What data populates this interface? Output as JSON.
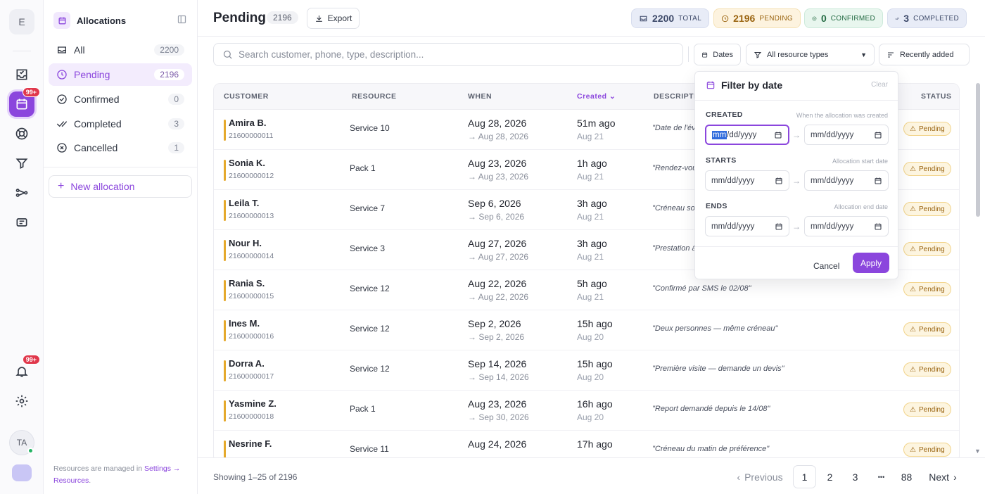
{
  "rail": {
    "workspace_initial": "E",
    "calendar_badge": "99+",
    "notif_badge": "99+",
    "avatar_initials": "TA"
  },
  "panel": {
    "title": "Allocations",
    "nav": [
      {
        "label": "All",
        "count": "2200"
      },
      {
        "label": "Pending",
        "count": "2196"
      },
      {
        "label": "Confirmed",
        "count": "0"
      },
      {
        "label": "Completed",
        "count": "3"
      },
      {
        "label": "Cancelled",
        "count": "1"
      }
    ],
    "new_label": "New allocation",
    "footer_text": "Resources are managed in",
    "footer_link": "Settings → Resources",
    "footer_end": "."
  },
  "header": {
    "title": "Pending",
    "count": "2196",
    "export_label": "Export",
    "stats": [
      {
        "value": "2200",
        "label": "TOTAL"
      },
      {
        "value": "2196",
        "label": "PENDING"
      },
      {
        "value": "0",
        "label": "CONFIRMED"
      },
      {
        "value": "3",
        "label": "COMPLETED"
      }
    ]
  },
  "toolbar": {
    "search_placeholder": "Search customer, phone, type, description...",
    "dates_label": "Dates",
    "type_filter": "All resource types",
    "sort_label": "Recently added"
  },
  "table": {
    "columns": [
      "CUSTOMER",
      "RESOURCE",
      "WHEN",
      "Created",
      "DESCRIPTIO",
      "STATUS"
    ],
    "rows": [
      {
        "name": "Amira B.",
        "phone": "21600000011",
        "resource": "Service 10",
        "when": "Aug 28, 2026",
        "when_end": "→ Aug 28, 2026",
        "created": "51m ago",
        "created_date": "Aug 21",
        "desc": "\"Date de l'évé",
        "status": "Pending"
      },
      {
        "name": "Sonia K.",
        "phone": "21600000012",
        "resource": "Pack 1",
        "when": "Aug 23, 2026",
        "when_end": "→ Aug 23, 2026",
        "created": "1h ago",
        "created_date": "Aug 21",
        "desc": "\"Rendez-vous",
        "status": "Pending"
      },
      {
        "name": "Leila T.",
        "phone": "21600000013",
        "resource": "Service 7",
        "when": "Sep 6, 2026",
        "when_end": "→ Sep 6, 2026",
        "created": "3h ago",
        "created_date": "Aug 21",
        "desc": "\"Créneau sou",
        "status": "Pending"
      },
      {
        "name": "Nour H.",
        "phone": "21600000014",
        "resource": "Service 3",
        "when": "Aug 27, 2026",
        "when_end": "→ Aug 27, 2026",
        "created": "3h ago",
        "created_date": "Aug 21",
        "desc": "\"Prestation à",
        "status": "Pending"
      },
      {
        "name": "Rania S.",
        "phone": "21600000015",
        "resource": "Service 12",
        "when": "Aug 22, 2026",
        "when_end": "→ Aug 22, 2026",
        "created": "5h ago",
        "created_date": "Aug 21",
        "desc": "\"Confirmé par SMS le 02/08\"",
        "status": "Pending"
      },
      {
        "name": "Ines M.",
        "phone": "21600000016",
        "resource": "Service 12",
        "when": "Sep 2, 2026",
        "when_end": "→ Sep 2, 2026",
        "created": "15h ago",
        "created_date": "Aug 20",
        "desc": "\"Deux personnes — même créneau\"",
        "status": "Pending"
      },
      {
        "name": "Dorra A.",
        "phone": "21600000017",
        "resource": "Service 12",
        "when": "Sep 14, 2026",
        "when_end": "→ Sep 14, 2026",
        "created": "15h ago",
        "created_date": "Aug 20",
        "desc": "\"Première visite — demande un devis\"",
        "status": "Pending"
      },
      {
        "name": "Yasmine Z.",
        "phone": "21600000018",
        "resource": "Pack 1",
        "when": "Aug 23, 2026",
        "when_end": "→ Sep 30, 2026",
        "created": "16h ago",
        "created_date": "Aug 20",
        "desc": "\"Report demandé depuis le 14/08\"",
        "status": "Pending"
      },
      {
        "name": "Nesrine F.",
        "phone": "",
        "resource": "Service 11",
        "when": "Aug 24, 2026",
        "when_end": "",
        "created": "17h ago",
        "created_date": "",
        "desc": "\"Créneau du matin de préférence\"",
        "status": "Pending"
      }
    ]
  },
  "pagination": {
    "showing": "Showing 1–25 of 2196",
    "prev": "Previous",
    "pages": [
      "1",
      "2",
      "3",
      "•••",
      "88"
    ],
    "next": "Next"
  },
  "date_filter": {
    "title": "Filter by date",
    "clear": "Clear",
    "sections": [
      {
        "label": "CREATED",
        "hint": "When the allocation was created"
      },
      {
        "label": "STARTS",
        "hint": "Allocation start date"
      },
      {
        "label": "ENDS",
        "hint": "Allocation end date"
      }
    ],
    "placeholder": "mm/dd/yyyy",
    "cancel": "Cancel",
    "apply": "Apply"
  },
  "colors": {
    "accent": "#8b46dd",
    "pending": "#e5a92c"
  }
}
